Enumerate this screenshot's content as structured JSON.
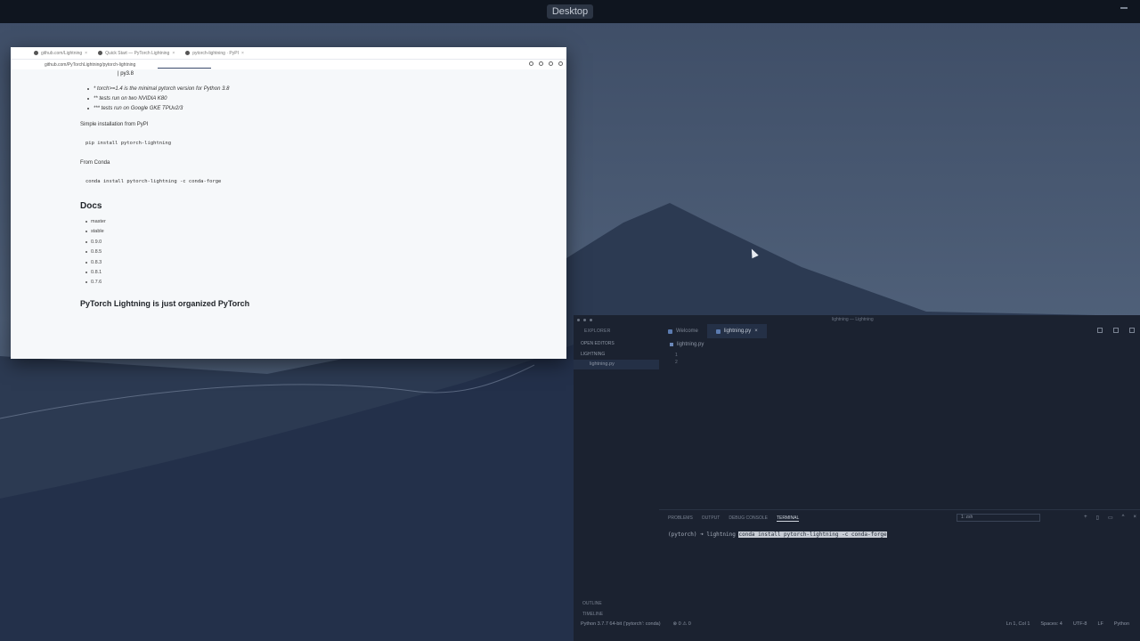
{
  "desktop": {
    "title": "Desktop"
  },
  "browser": {
    "tabs": [
      {
        "label": "github.com/Lightning",
        "close": "×"
      },
      {
        "label": "Quick Start — PyTorch Lightning",
        "close": "×"
      },
      {
        "label": "pytorch-lightning · PyPI",
        "close": "×"
      }
    ],
    "url": "github.com/PyTorchLightning/pytorch-lightning",
    "py_tag": "| py3.8",
    "notes": [
      "* torch>=1.4 is the minimal pytorch version for Python 3.8",
      "** tests run on two NVIDIA K80",
      "*** tests run on Google GKE TPUv2/3"
    ],
    "pypi_label": "Simple installation from PyPI",
    "pypi_cmd": "pip install pytorch-lightning",
    "conda_label": "From Conda",
    "conda_cmd": "conda install pytorch-lightning -c conda-forge",
    "docs_heading": "Docs",
    "docs_items": [
      "master",
      "stable",
      "0.9.0",
      "0.8.5",
      "0.8.3",
      "0.8.1",
      "0.7.6"
    ],
    "org_heading": "PyTorch Lightning is just organized PyTorch"
  },
  "vscode": {
    "title": "lightning — Lightning",
    "sidebar": {
      "header": "EXPLORER",
      "open_editors": "OPEN EDITORS",
      "folder": "LIGHTNING",
      "file": "lightning.py",
      "outline": "OUTLINE",
      "timeline": "TIMELINE"
    },
    "tabs": [
      {
        "label": "Welcome"
      },
      {
        "label": "lightning.py",
        "close": "×"
      }
    ],
    "breadcrumb": "lightning.py",
    "line_numbers": [
      "1",
      "2"
    ],
    "panel_tabs": [
      "PROBLEMS",
      "OUTPUT",
      "DEBUG CONSOLE",
      "TERMINAL"
    ],
    "terminal_select": "1: zsh",
    "terminal_prompt": "(pytorch) ➜  lightning ",
    "terminal_cmd": "conda install pytorch-lightning -c conda-forge",
    "status_left": [
      "Python 3.7.7 64-bit ('pytorch': conda)",
      "⊗ 0 ⚠ 0"
    ],
    "status_right": [
      "Ln 1, Col 1",
      "Spaces: 4",
      "UTF-8",
      "LF",
      "Python"
    ]
  }
}
